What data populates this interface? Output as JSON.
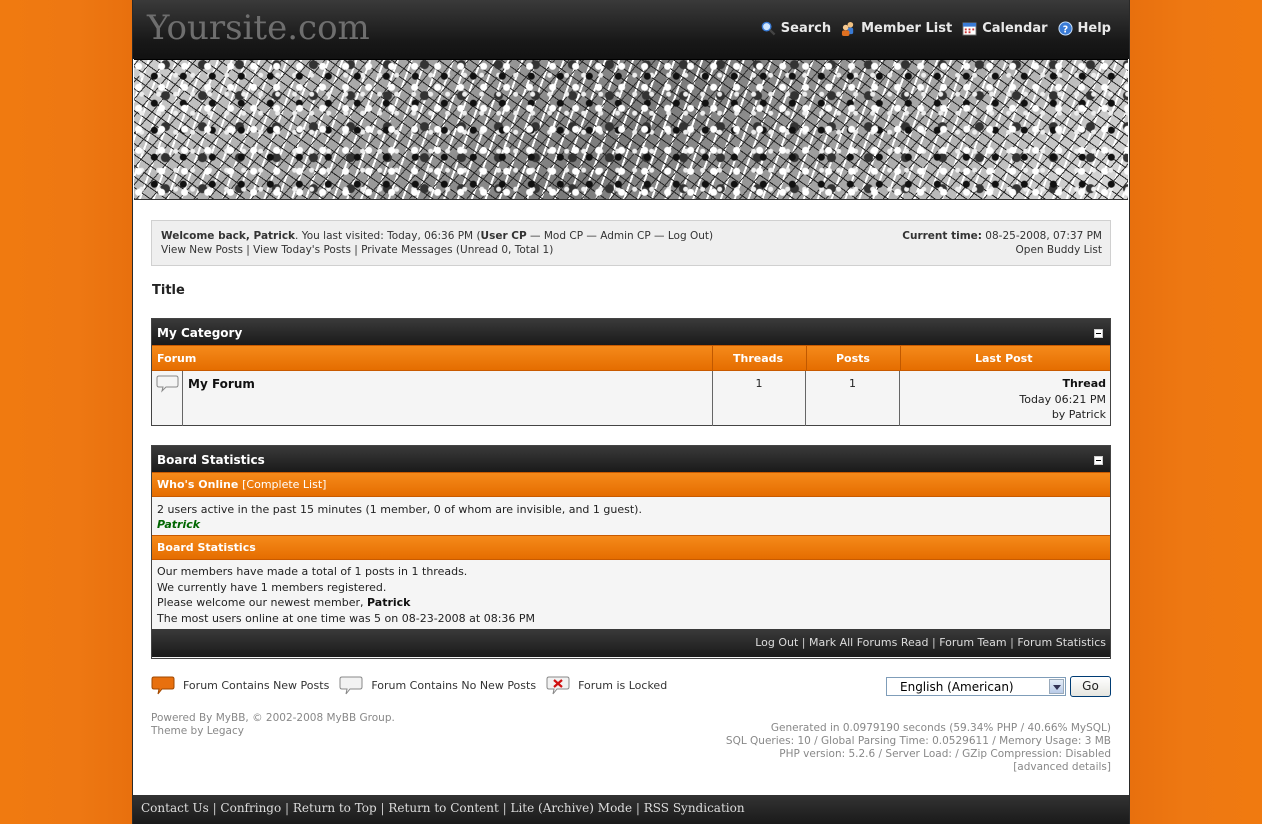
{
  "header": {
    "logo": "Yoursite.com",
    "nav": [
      {
        "label": "Search",
        "icon": "search-icon"
      },
      {
        "label": "Member List",
        "icon": "members-icon"
      },
      {
        "label": "Calendar",
        "icon": "calendar-icon"
      },
      {
        "label": "Help",
        "icon": "help-icon"
      }
    ]
  },
  "welcome": {
    "greeting": "Welcome back, Patrick",
    "last_visit": ". You last visited: Today, 06:36 PM (",
    "user_cp": "User CP",
    "mod_cp": "Mod CP",
    "admin_cp": "Admin CP",
    "logout": "Log Out",
    "dash": " — ",
    "close_paren": ")",
    "view_new": "View New Posts",
    "view_today": "View Today's Posts",
    "private_messages": "Private Messages",
    "pm_counts": " (Unread 0, Total 1)",
    "pipe": " | ",
    "current_time_label": "Current time:",
    "current_time": " 08-25-2008, 07:37 PM",
    "buddy_list": "Open Buddy List"
  },
  "page_title": "Title",
  "category": {
    "name": "My Category",
    "columns": {
      "forum": "Forum",
      "threads": "Threads",
      "posts": "Posts",
      "last_post": "Last Post"
    },
    "forums": [
      {
        "name": "My Forum",
        "threads": "1",
        "posts": "1",
        "last_post_title": "Thread",
        "last_post_time": "Today 06:21 PM",
        "last_post_by": "by Patrick"
      }
    ]
  },
  "stats": {
    "title": "Board Statistics",
    "whos_online_label": "Who's Online",
    "complete_list": "[Complete List]",
    "online_text": "2 users active in the past 15 minutes (1 member, 0 of whom are invisible, and 1 guest).",
    "online_user": "Patrick",
    "section2_label": "Board Statistics",
    "line1": "Our members have made a total of 1 posts in 1 threads.",
    "line2": "We currently have 1 members registered.",
    "line3_prefix": "Please welcome our newest member, ",
    "line3_member": "Patrick",
    "line4": "The most users online at one time was 5 on 08-23-2008 at 08:36 PM",
    "footer_links": [
      "Log Out",
      "Mark All Forums Read",
      "Forum Team",
      "Forum Statistics"
    ]
  },
  "legend": {
    "new_posts": "Forum Contains New Posts",
    "no_new_posts": "Forum Contains No New Posts",
    "locked": "Forum is Locked"
  },
  "language": {
    "selected": "English (American)",
    "go": "Go"
  },
  "powered": {
    "line1": "Powered By MyBB, © 2002-2008 MyBB Group.",
    "line2": "Theme by Legacy"
  },
  "debug": {
    "line1": "Generated in 0.0979190 seconds (59.34% PHP / 40.66% MySQL)",
    "line2": "SQL Queries: 10 / Global Parsing Time: 0.0529611 / Memory Usage: 3 MB",
    "line3": "PHP version: 5.2.6 / Server Load: / GZip Compression: Disabled",
    "line4": "[advanced details]"
  },
  "bottom_links": [
    "Contact Us",
    "Confringo",
    "Return to Top",
    "Return to Content",
    "Lite (Archive) Mode",
    "RSS Syndication"
  ],
  "colors": {
    "accent": "#e8700e",
    "dark": "#1a1a1a",
    "online_user": "#006600"
  }
}
